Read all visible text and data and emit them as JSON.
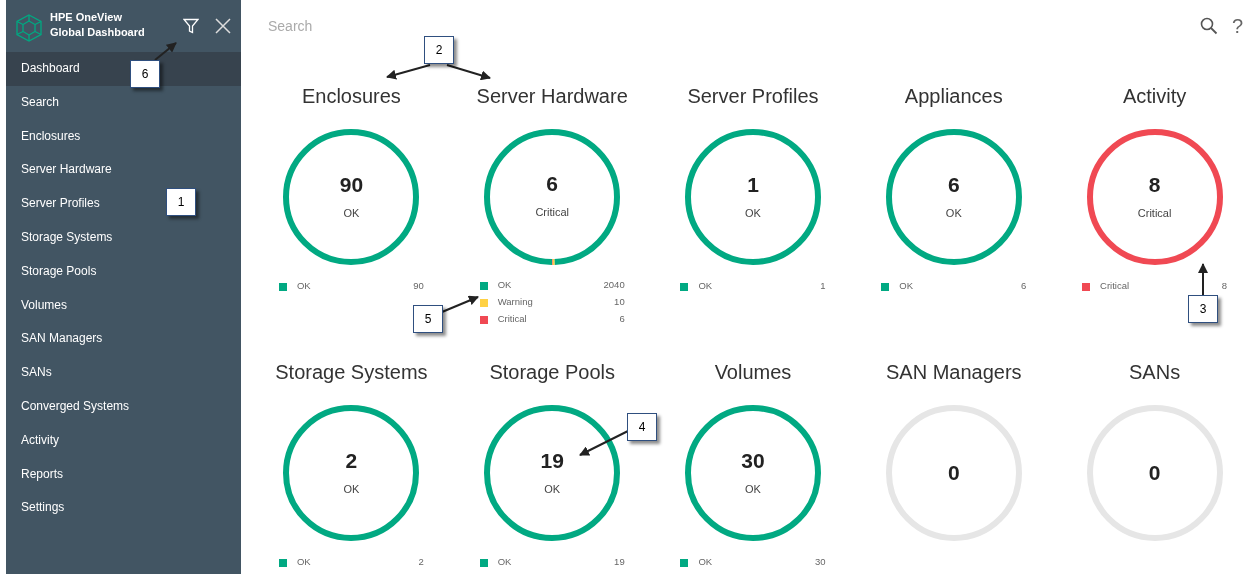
{
  "app": {
    "title_line_1": "HPE OneView",
    "title_line_2": "Global Dashboard"
  },
  "sidebar": {
    "items": [
      {
        "label": "Dashboard",
        "selected": true
      },
      {
        "label": "Search",
        "selected": false
      },
      {
        "label": "Enclosures",
        "selected": false
      },
      {
        "label": "Server Hardware",
        "selected": false
      },
      {
        "label": "Server Profiles",
        "selected": false
      },
      {
        "label": "Storage Systems",
        "selected": false
      },
      {
        "label": "Storage Pools",
        "selected": false
      },
      {
        "label": "Volumes",
        "selected": false
      },
      {
        "label": "SAN Managers",
        "selected": false
      },
      {
        "label": "SANs",
        "selected": false
      },
      {
        "label": "Converged Systems",
        "selected": false
      },
      {
        "label": "Activity",
        "selected": false
      },
      {
        "label": "Reports",
        "selected": false
      },
      {
        "label": "Settings",
        "selected": false
      }
    ]
  },
  "search": {
    "placeholder": "Search",
    "help": "?"
  },
  "cards": [
    {
      "title": "Enclosures",
      "count": "90",
      "status": "OK",
      "legend": [
        {
          "label": "OK",
          "count": "90",
          "color": "#01a982"
        }
      ]
    },
    {
      "title": "Server Hardware",
      "count": "6",
      "status": "Critical",
      "legend": [
        {
          "label": "OK",
          "count": "2040",
          "color": "#01a982"
        },
        {
          "label": "Warning",
          "count": "10",
          "color": "#ffd144"
        },
        {
          "label": "Critical",
          "count": "6",
          "color": "#f04953"
        }
      ]
    },
    {
      "title": "Server Profiles",
      "count": "1",
      "status": "OK",
      "legend": [
        {
          "label": "OK",
          "count": "1",
          "color": "#01a982"
        }
      ]
    },
    {
      "title": "Appliances",
      "count": "6",
      "status": "OK",
      "legend": [
        {
          "label": "OK",
          "count": "6",
          "color": "#01a982"
        }
      ]
    },
    {
      "title": "Activity",
      "count": "8",
      "status": "Critical",
      "legend": [
        {
          "label": "Critical",
          "count": "8",
          "color": "#f04953"
        }
      ]
    },
    {
      "title": "Storage Systems",
      "count": "2",
      "status": "OK",
      "legend": [
        {
          "label": "OK",
          "count": "2",
          "color": "#01a982"
        }
      ]
    },
    {
      "title": "Storage Pools",
      "count": "19",
      "status": "OK",
      "legend": [
        {
          "label": "OK",
          "count": "19",
          "color": "#01a982"
        }
      ]
    },
    {
      "title": "Volumes",
      "count": "30",
      "status": "OK",
      "legend": [
        {
          "label": "OK",
          "count": "30",
          "color": "#01a982"
        }
      ]
    },
    {
      "title": "SAN Managers",
      "count": "0"
    },
    {
      "title": "SANs",
      "count": "0"
    }
  ],
  "callouts": [
    {
      "label": "1"
    },
    {
      "label": "2"
    },
    {
      "label": "3"
    },
    {
      "label": "4"
    },
    {
      "label": "5"
    },
    {
      "label": "6"
    }
  ]
}
